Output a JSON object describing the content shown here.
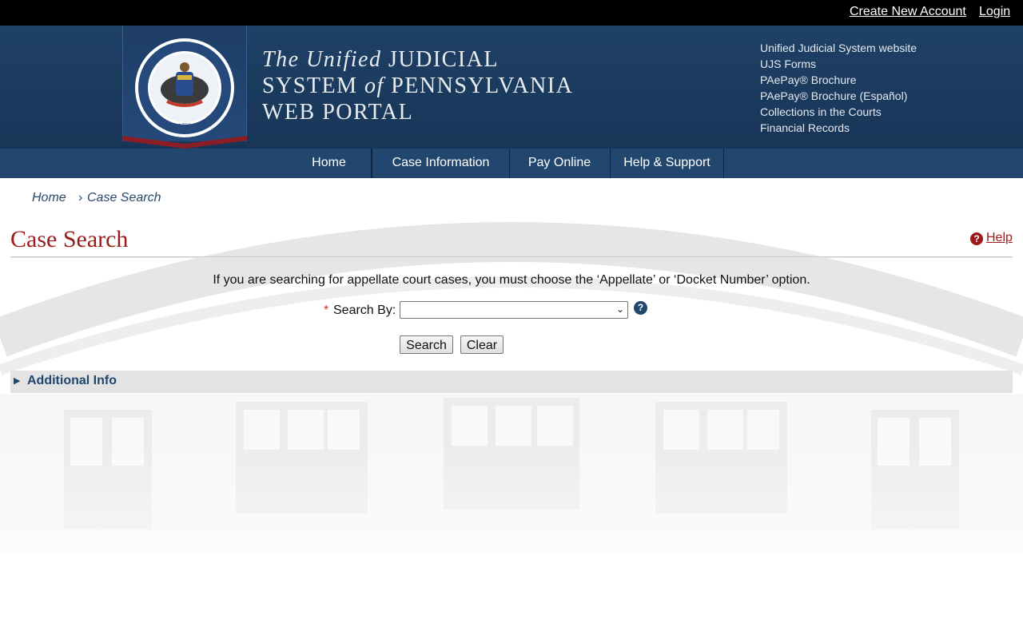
{
  "topbar": {
    "create_account": "Create New Account",
    "login": "Login"
  },
  "header": {
    "seal_alt": "Seal of the Supreme Court of Pennsylvania 1722",
    "title_line1_italic": "The Unified",
    "title_line1_rest": "JUDICIAL",
    "title_line2_a": "SYSTEM",
    "title_line2_italic": "of",
    "title_line2_b": "PENNSYLVANIA",
    "title_line3": "WEB PORTAL",
    "links": [
      "Unified Judicial System website",
      "UJS Forms",
      "PAePay® Brochure",
      "PAePay® Brochure (Español)",
      "Collections in the Courts",
      "Financial Records"
    ]
  },
  "nav": [
    "Home",
    "Case Information",
    "Pay Online",
    "Help & Support"
  ],
  "breadcrumb": {
    "home": "Home",
    "separator": "›",
    "current": "Case Search"
  },
  "page": {
    "title": "Case Search",
    "help": "Help",
    "notice": "If you are searching for appellate court cases, you must choose the ‘Appellate’ or ‘Docket Number’ option.",
    "required_marker": "*",
    "search_by_label": "Search By:",
    "search_by_value": "",
    "search_button": "Search",
    "clear_button": "Clear",
    "additional_info": "Additional Info"
  },
  "colors": {
    "header_blue": "#1f4166",
    "nav_blue": "#21476f",
    "title_red": "#9b1b1b",
    "seal_ribbon": "#8b1e24"
  }
}
